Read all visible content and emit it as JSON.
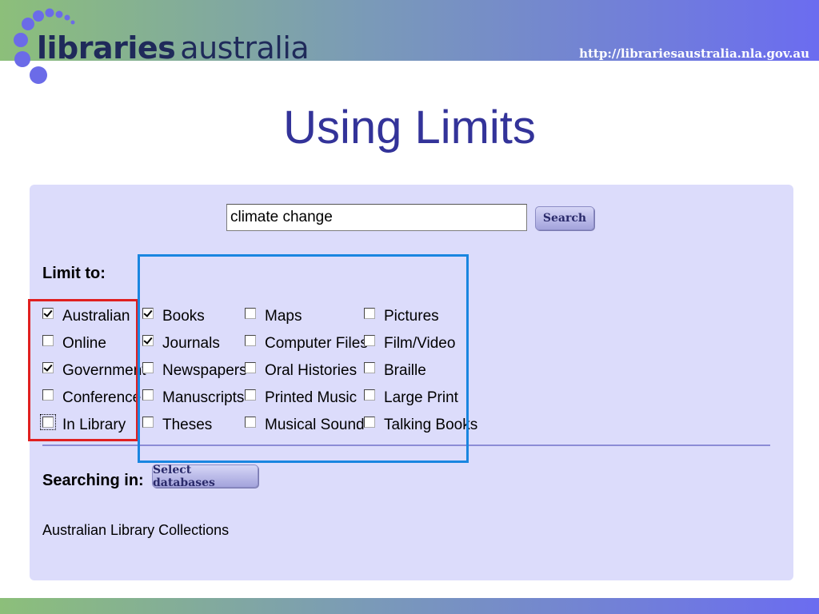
{
  "header": {
    "logo_bold": "libraries",
    "logo_light": "australia",
    "url": "http://librariesaustralia.nla.gov.au"
  },
  "slide": {
    "title": "Using Limits"
  },
  "search": {
    "value": "climate change",
    "button_label": "Search"
  },
  "limits": {
    "label": "Limit to:",
    "columns": [
      [
        {
          "label": "Australian",
          "checked": true
        },
        {
          "label": "Online",
          "checked": false
        },
        {
          "label": "Government",
          "checked": true
        },
        {
          "label": "Conference",
          "checked": false
        },
        {
          "label": "In Library",
          "checked": false,
          "focused": true
        }
      ],
      [
        {
          "label": "Books",
          "checked": true
        },
        {
          "label": "Journals",
          "checked": true
        },
        {
          "label": "Newspapers",
          "checked": false
        },
        {
          "label": "Manuscripts",
          "checked": false
        },
        {
          "label": "Theses",
          "checked": false
        }
      ],
      [
        {
          "label": "Maps",
          "checked": false
        },
        {
          "label": "Computer Files",
          "checked": false
        },
        {
          "label": "Oral Histories",
          "checked": false
        },
        {
          "label": "Printed Music",
          "checked": false
        },
        {
          "label": "Musical Sound",
          "checked": false
        }
      ],
      [
        {
          "label": "Pictures",
          "checked": false
        },
        {
          "label": "Film/Video",
          "checked": false
        },
        {
          "label": "Braille",
          "checked": false
        },
        {
          "label": "Large Print",
          "checked": false
        },
        {
          "label": "Talking Books",
          "checked": false
        }
      ]
    ]
  },
  "searching": {
    "label": "Searching in:",
    "button_label": "Select databases",
    "collections": "Australian Library Collections"
  },
  "colors": {
    "title": "#333399",
    "highlight_red": "#e02020",
    "highlight_blue": "#1a86e0",
    "panel_bg": "#dcdcfb"
  }
}
